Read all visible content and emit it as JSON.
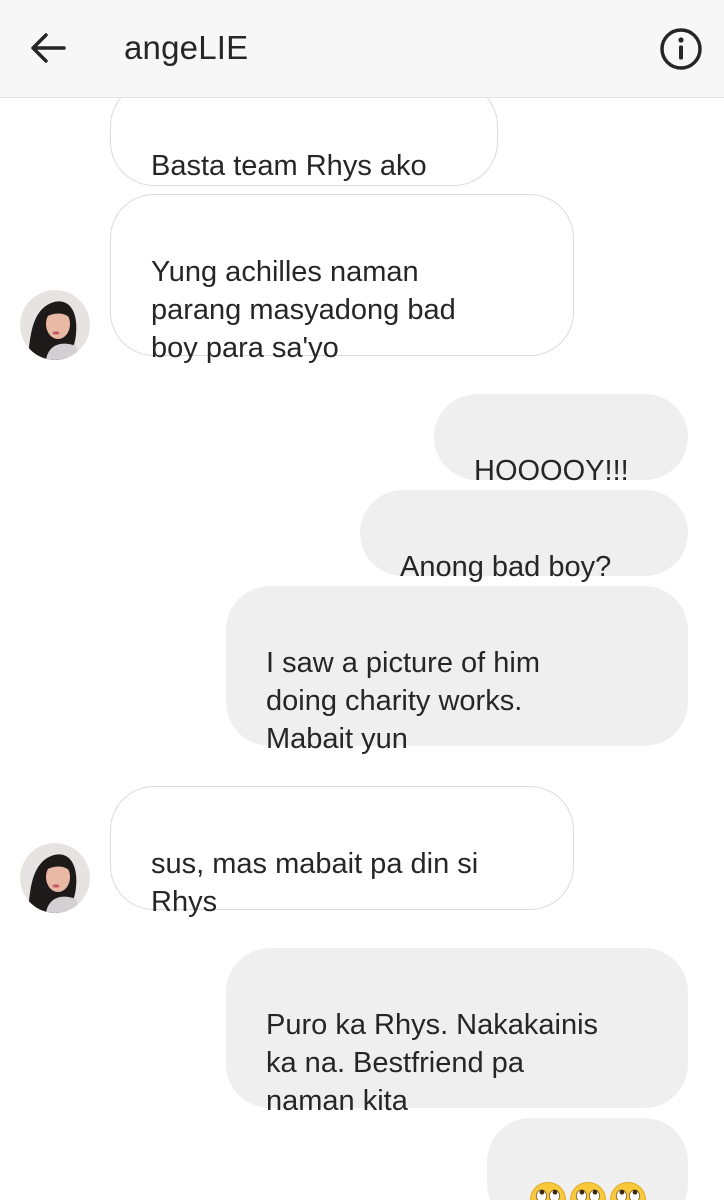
{
  "header": {
    "title": "angeLIE",
    "back_icon": "arrow-left-icon",
    "info_icon": "info-circle-icon"
  },
  "colors": {
    "sent_bubble": "#efefef",
    "received_border": "#dbdbdb",
    "text": "#262626"
  },
  "messages": [
    {
      "direction": "received",
      "text": "Basta team Rhys ako"
    },
    {
      "direction": "received",
      "text": "Yung achilles naman\nparang  masyadong bad\nboy para sa'yo"
    },
    {
      "direction": "sent",
      "text": "HOOOOY!!!"
    },
    {
      "direction": "sent",
      "text": "Anong bad boy?"
    },
    {
      "direction": "sent",
      "text": "I saw a picture of him\ndoing charity works.\nMabait yun"
    },
    {
      "direction": "received",
      "text": "sus, mas mabait pa din si\nRhys"
    },
    {
      "direction": "sent",
      "text": "Puro ka Rhys. Nakakainis\nka na. Bestfriend pa\nnaman kita"
    },
    {
      "direction": "sent",
      "text": "",
      "emoji": [
        "face-with-rolling-eyes",
        "face-with-rolling-eyes",
        "face-with-rolling-eyes"
      ]
    }
  ]
}
